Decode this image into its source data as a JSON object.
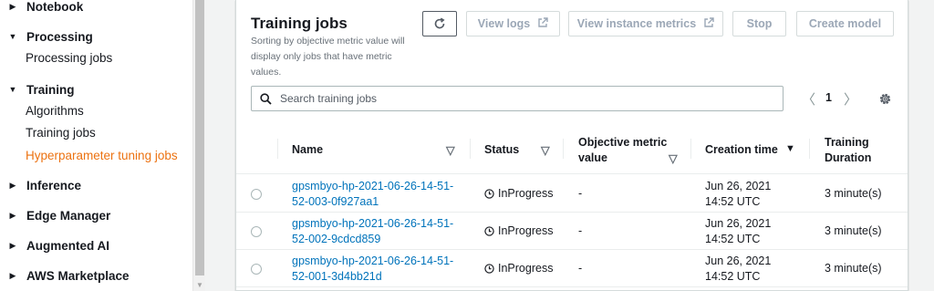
{
  "sidebar": {
    "sections": [
      {
        "label": "Notebook",
        "caret": "▶"
      },
      {
        "label": "Processing",
        "caret": "▼",
        "items": [
          "Processing jobs"
        ]
      },
      {
        "label": "Training",
        "caret": "▼",
        "items": [
          "Algorithms",
          "Training jobs",
          "Hyperparameter tuning jobs"
        ]
      },
      {
        "label": "Inference",
        "caret": "▶"
      },
      {
        "label": "Edge Manager",
        "caret": "▶"
      },
      {
        "label": "Augmented AI",
        "caret": "▶"
      },
      {
        "label": "AWS Marketplace",
        "caret": "▶"
      }
    ],
    "active_item": "Hyperparameter tuning jobs"
  },
  "header": {
    "title": "Training jobs",
    "subtitle": "Sorting by objective metric value will display only jobs that have metric values.",
    "buttons": {
      "refresh": "C",
      "view_logs": "View logs",
      "view_instance_metrics": "View instance metrics",
      "stop": "Stop",
      "create_model": "Create model"
    }
  },
  "search": {
    "placeholder": "Search training jobs"
  },
  "pagination": {
    "current_page": "1",
    "prev": "〈",
    "next": "〉"
  },
  "table": {
    "columns": {
      "name": "Name",
      "status": "Status",
      "objective_line1": "Objective metric",
      "objective_line2": "value",
      "creation_time": "Creation time",
      "duration_line1": "Training",
      "duration_line2": "Duration"
    },
    "rows": [
      {
        "name_line1": "gpsmbyo-hp-2021-06-26-14-51-",
        "name_line2": "52-003-0f927aa1",
        "status": "InProgress",
        "objective": "-",
        "created_line1": "Jun 26, 2021",
        "created_line2": "14:52 UTC",
        "duration": "3 minute(s)"
      },
      {
        "name_line1": "gpsmbyo-hp-2021-06-26-14-51-",
        "name_line2": "52-002-9cdcd859",
        "status": "InProgress",
        "objective": "-",
        "created_line1": "Jun 26, 2021",
        "created_line2": "14:52 UTC",
        "duration": "3 minute(s)"
      },
      {
        "name_line1": "gpsmbyo-hp-2021-06-26-14-51-",
        "name_line2": "52-001-3d4bb21d",
        "status": "InProgress",
        "objective": "-",
        "created_line1": "Jun 26, 2021",
        "created_line2": "14:52 UTC",
        "duration": "3 minute(s)"
      }
    ]
  },
  "colors": {
    "accent": "#ec7211",
    "link": "#0073bb",
    "disabled": "#9ba7b6"
  }
}
